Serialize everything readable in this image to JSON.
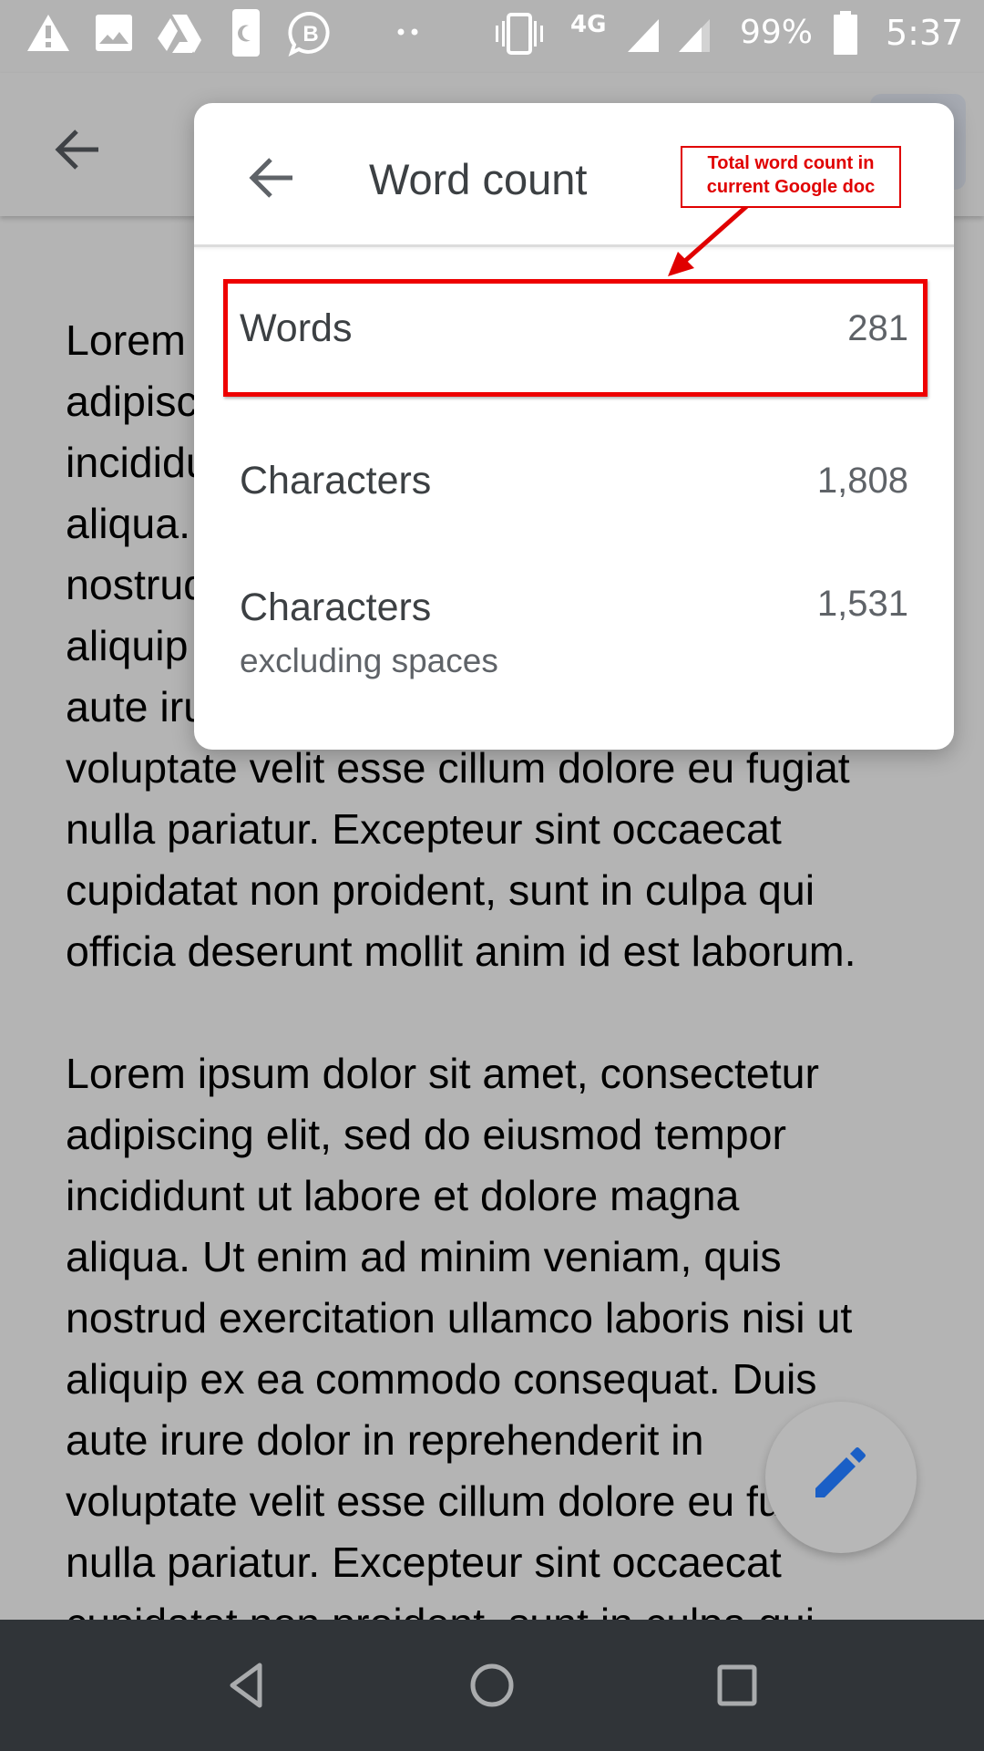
{
  "status_bar": {
    "left_icons": [
      "warning-icon",
      "image-icon",
      "drive-icon",
      "do-not-disturb-phone-icon",
      "whatsapp-business-icon",
      "more-notifications-icon"
    ],
    "network_type": "4G",
    "battery_percent": "99%",
    "battery_level": 0.99,
    "time": "5:37"
  },
  "app_bar": {
    "back_icon": "arrow-back-icon"
  },
  "document": {
    "paragraphs": [
      "Lorem ipsum dolor sit amet, consectetur\nadipiscing elit, sed do eiusmod tempor\nincididunt ut labore et dolore magna\naliqua. Ut enim ad minim veniam, quis\nnostrud exercitation ullamco laboris nisi ut\naliquip ex ea commodo consequat. Duis\naute irure dolor in reprehenderit in\nvoluptate velit esse cillum dolore eu fugiat\nnulla pariatur. Excepteur sint occaecat\ncupidatat non proident, sunt in culpa qui\nofficia deserunt mollit anim id est laborum.",
      "Lorem ipsum dolor sit amet, consectetur\nadipiscing elit, sed do eiusmod tempor\nincididunt ut labore et dolore magna\naliqua. Ut enim ad minim veniam, quis\nnostrud exercitation ullamco laboris nisi ut\naliquip ex ea commodo consequat. Duis\naute irure dolor in reprehenderit in\nvoluptate velit esse cillum dolore eu fugiat\nnulla pariatur. Excepteur sint occaecat\ncupidatat non proident, sunt in culpa qui"
    ]
  },
  "dialog": {
    "title": "Word count",
    "rows": [
      {
        "label": "Words",
        "value": "281"
      },
      {
        "label": "Characters",
        "value": "1,808"
      },
      {
        "label": "Characters",
        "sublabel": "excluding spaces",
        "value": "1,531"
      }
    ]
  },
  "annotation": {
    "text_line1": "Total word count in",
    "text_line2": "current Google doc",
    "color": "#e00000"
  },
  "fab": {
    "icon": "edit-pencil-icon",
    "color": "#1a5fc6"
  },
  "nav_bar": {
    "buttons": [
      "back",
      "home",
      "recents"
    ]
  }
}
